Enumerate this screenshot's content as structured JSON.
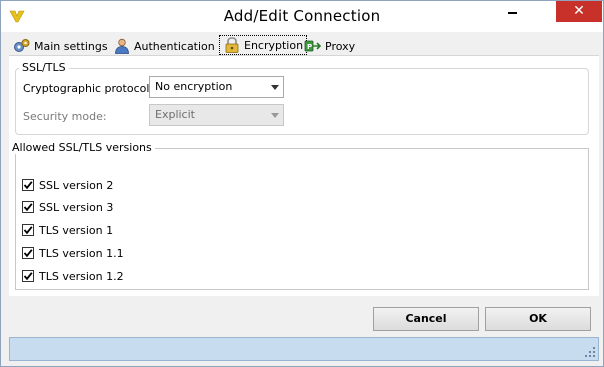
{
  "window": {
    "title": "Add/Edit Connection",
    "close_glyph": "✕",
    "accent_color": "#c7312a",
    "statusbar_color": "#c8dcf0"
  },
  "tabs": [
    {
      "label": "Main settings",
      "icon": "gears-icon",
      "active": false
    },
    {
      "label": "Authentication",
      "icon": "user-icon",
      "active": false
    },
    {
      "label": "Encryption",
      "icon": "lock-icon",
      "active": true
    },
    {
      "label": "Proxy",
      "icon": "proxy-icon",
      "active": false
    }
  ],
  "ssl_group": {
    "title": "SSL/TLS",
    "protocol_label": "Cryptographic protocol:",
    "protocol_value": "No encryption",
    "security_label": "Security mode:",
    "security_value": "Explicit"
  },
  "versions_group": {
    "title": "Allowed SSL/TLS versions",
    "items": [
      {
        "label": "SSL version 2",
        "checked": true
      },
      {
        "label": "SSL version 3",
        "checked": true
      },
      {
        "label": "TLS version 1",
        "checked": true
      },
      {
        "label": "TLS version 1.1",
        "checked": true
      },
      {
        "label": "TLS version 1.2",
        "checked": true
      }
    ]
  },
  "buttons": {
    "cancel": "Cancel",
    "ok": "OK"
  }
}
